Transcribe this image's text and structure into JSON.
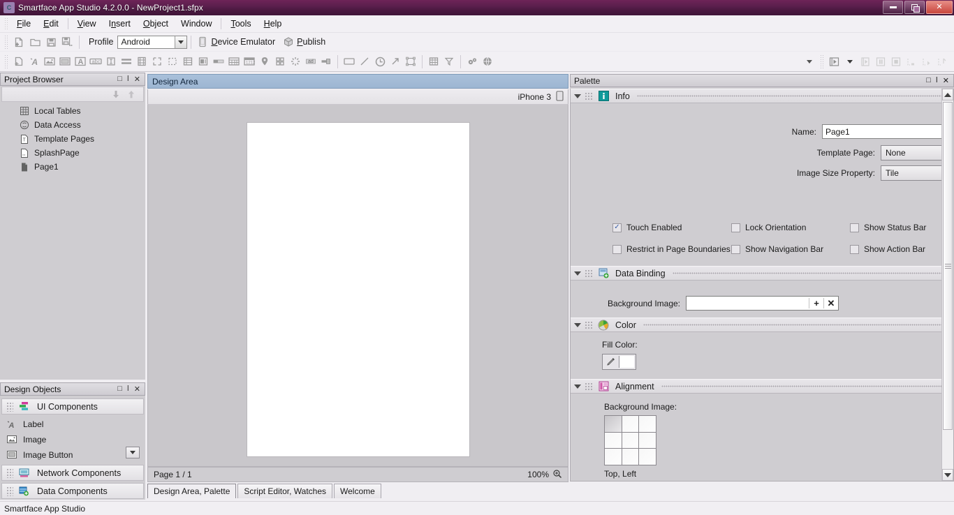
{
  "window": {
    "title": "Smartface App Studio 4.2.0.0 - NewProject1.sfpx",
    "minimize": "–",
    "restore": "❐",
    "close": "✕"
  },
  "menubar": {
    "items": [
      {
        "label": "File"
      },
      {
        "label": "Edit"
      },
      {
        "label": "View"
      },
      {
        "label": "Insert"
      },
      {
        "label": "Object"
      },
      {
        "label": "Window"
      },
      {
        "label": "Tools"
      },
      {
        "label": "Help"
      }
    ]
  },
  "toolbar_main": {
    "new_icon": "new-project-icon",
    "open_icon": "open-folder-icon",
    "save_icon": "save-icon",
    "saveall_icon": "save-all-icon",
    "profile_label": "Profile",
    "profile_value": "Android",
    "device_emulator_label": "Device Emulator",
    "device_emulator_icon": "phone-icon",
    "publish_label": "Publish",
    "publish_icon": "publish-box-icon"
  },
  "toolbar_components": {
    "icons": [
      "add-page-icon",
      "label-icon",
      "image-icon",
      "image-button-icon",
      "text-button-icon",
      "text-box-icon",
      "text-area-icon",
      "slider-icon",
      "video-icon",
      "container-icon",
      "dashed-box-icon",
      "list-view-icon",
      "progress-bar-icon",
      "grid-icon",
      "date-picker-icon",
      "map-pin-icon",
      "tile-grid-icon",
      "activity-indicator-icon",
      "ad-banner-icon",
      "switch-icon",
      "rectangle-icon",
      "line-icon",
      "clock-icon",
      "arrow-icon",
      "selection-icon",
      "table-icon",
      "filter-icon",
      "settings-gears-icon",
      "globe-icon"
    ],
    "run_icons": [
      "run-icon",
      "run-dropdown-icon",
      "step-into-icon",
      "pause-icon",
      "stop-icon",
      "step-over-icon",
      "step-out-icon",
      "step-return-icon"
    ]
  },
  "project_browser": {
    "title": "Project Browser",
    "controls": [
      "□",
      "ǀ",
      "✕"
    ],
    "sort_down_icon": "arrow-down-icon",
    "sort_up_icon": "arrow-up-icon",
    "items": [
      {
        "label": "Local Tables",
        "icon": "table-icon"
      },
      {
        "label": "Data Access",
        "icon": "data-access-icon"
      },
      {
        "label": "Template Pages",
        "icon": "template-page-icon"
      },
      {
        "label": "SplashPage",
        "icon": "splash-page-icon"
      },
      {
        "label": "Page1",
        "icon": "page-icon"
      }
    ]
  },
  "design_objects": {
    "title": "Design Objects",
    "controls": [
      "□",
      "ǀ",
      "✕"
    ],
    "groups": [
      {
        "label": "UI Components",
        "icon": "ui-components-icon"
      },
      {
        "label": "Network Components",
        "icon": "network-components-icon"
      },
      {
        "label": "Data Components",
        "icon": "data-components-icon"
      }
    ],
    "items": [
      {
        "label": "Label",
        "icon": "label-icon"
      },
      {
        "label": "Image",
        "icon": "image-icon"
      },
      {
        "label": "Image Button",
        "icon": "image-button-icon"
      }
    ],
    "more_icon": "chevron-down-icon"
  },
  "design_area": {
    "title": "Design Area",
    "device": "iPhone 3",
    "device_icon": "phone-icon",
    "page_status": "Page 1 / 1",
    "zoom": "100%",
    "zoom_icon": "zoom-in-icon"
  },
  "bottom_tabs": {
    "tabs": [
      {
        "label": "Design Area, Palette",
        "active": true
      },
      {
        "label": "Script Editor,  Watches",
        "active": false
      },
      {
        "label": "Welcome",
        "active": false
      }
    ]
  },
  "palette": {
    "title": "Palette",
    "controls": [
      "□",
      "ǀ",
      "✕"
    ],
    "sections": {
      "info": {
        "label": "Info",
        "icon": "info-icon",
        "name_label": "Name:",
        "name_value": "Page1",
        "template_page_label": "Template Page:",
        "template_page_value": "None",
        "image_size_label": "Image Size Property:",
        "image_size_value": "Tile",
        "checkboxes": [
          {
            "label": "Touch Enabled",
            "checked": true
          },
          {
            "label": "Lock Orientation",
            "checked": false
          },
          {
            "label": "Show Status Bar",
            "checked": false
          },
          {
            "label": "Restrict in Page Boundaries",
            "checked": false
          },
          {
            "label": "Show Navigation Bar",
            "checked": false
          },
          {
            "label": "Show Action Bar",
            "checked": false
          }
        ]
      },
      "data_binding": {
        "label": "Data Binding",
        "icon": "data-binding-icon",
        "background_image_label": "Background Image:",
        "background_image_value": "",
        "add_label": "+",
        "clear_label": "✕"
      },
      "color": {
        "label": "Color",
        "icon": "color-wheel-icon",
        "fill_color_label": "Fill Color:",
        "fill_color_value": "#FFFFFF",
        "picker_icon": "eyedropper-icon"
      },
      "alignment": {
        "label": "Alignment",
        "icon": "alignment-icon",
        "background_image_label": "Background Image:",
        "selected_cell": 0,
        "selected_label": "Top, Left"
      }
    }
  },
  "statusbar": {
    "text": "Smartface App Studio"
  }
}
